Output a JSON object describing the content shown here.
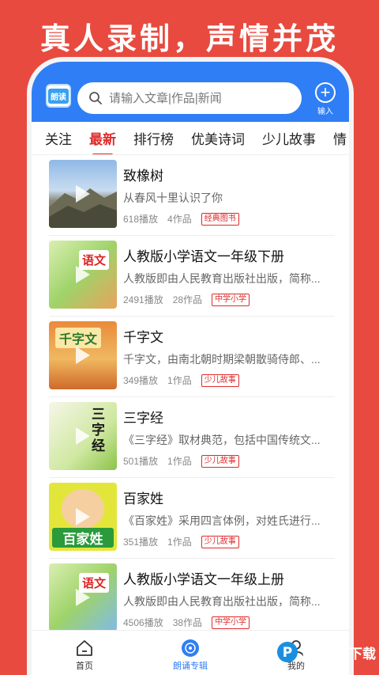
{
  "headline": "真人录制，声情并茂",
  "app": {
    "logo_text": "朗读"
  },
  "search": {
    "placeholder": "请输入文章|作品|新闻"
  },
  "input_button": {
    "label": "输入"
  },
  "tabs": [
    {
      "label": "关注"
    },
    {
      "label": "最新"
    },
    {
      "label": "排行榜"
    },
    {
      "label": "优美诗词"
    },
    {
      "label": "少儿故事"
    },
    {
      "label": "情"
    }
  ],
  "items": [
    {
      "title": "致橡树",
      "desc": "从春风十里认识了你",
      "plays": "618播放",
      "works": "4作品",
      "tag": "经典图书"
    },
    {
      "title": "人教版小学语文一年级下册",
      "desc": "人教版即由人民教育出版社出版，简称...",
      "plays": "2491播放",
      "works": "28作品",
      "tag": "中学小学"
    },
    {
      "title": "千字文",
      "desc": "千字文，由南北朝时期梁朝散骑侍郎、...",
      "plays": "349播放",
      "works": "1作品",
      "tag": "少儿故事"
    },
    {
      "title": "三字经",
      "desc": "《三字经》取材典范，包括中国传统文...",
      "plays": "501播放",
      "works": "1作品",
      "tag": "少儿故事"
    },
    {
      "title": "百家姓",
      "desc": "《百家姓》采用四言体例，对姓氏进行...",
      "plays": "351播放",
      "works": "1作品",
      "tag": "少儿故事"
    },
    {
      "title": "人教版小学语文一年级上册",
      "desc": "人教版即由人民教育出版社出版，简称...",
      "plays": "4506播放",
      "works": "38作品",
      "tag": "中学小学"
    }
  ],
  "thumb_text": {
    "yuwen": "语文",
    "qianziwen": "千字文",
    "sanzijing": "三字经",
    "baijiaxing": "百家姓"
  },
  "bottom_nav": {
    "home": "首页",
    "album": "朗诵专辑",
    "mine": "我的"
  },
  "watermark": "PCPOP下载",
  "colors": {
    "accent": "#2f7ef5",
    "brand_red": "#e84a3f",
    "active_tab": "#e02a2a"
  }
}
